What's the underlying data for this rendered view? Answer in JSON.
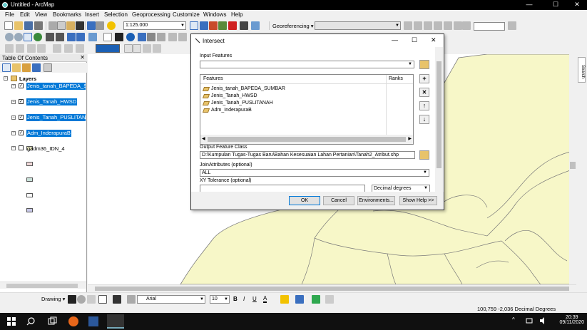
{
  "window": {
    "title": "Untitled - ArcMap",
    "minimize": "—",
    "maximize": "☐",
    "close": "✕"
  },
  "menu": [
    "File",
    "Edit",
    "View",
    "Bookmarks",
    "Insert",
    "Selection",
    "Geoprocessing",
    "Customize",
    "Windows",
    "Help"
  ],
  "toolbar": {
    "scale": "1:125.000",
    "georeferencing_label": "Georeferencing ▾"
  },
  "toc": {
    "title": "Table Of Contents",
    "close": "✕",
    "root": "Layers",
    "layers": [
      {
        "name": "Jenis_tanah_BAPEDA_SUMBAR",
        "checked": true,
        "selected": true,
        "color": "#f2f2c8"
      },
      {
        "name": "Jenis_Tanah_HWSD",
        "checked": true,
        "selected": true,
        "color": "#f0d8d8"
      },
      {
        "name": "Jenis_Tanah_PUSLITANAH",
        "checked": true,
        "selected": true,
        "color": "#c8e0d8"
      },
      {
        "name": "Adm_InderapuraB",
        "checked": true,
        "selected": true,
        "color": "#ffffff"
      },
      {
        "name": "gadm36_IDN_4",
        "checked": false,
        "selected": false,
        "color": "#c8c8e8"
      }
    ]
  },
  "dialog": {
    "title": "Intersect",
    "minimize": "—",
    "maximize": "☐",
    "close": "✕",
    "input_features_label": "Input Features",
    "features_header": "Features",
    "ranks_header": "Ranks",
    "features": [
      "Jenis_tanah_BAPEDA_SUMBAR",
      "Jenis_Tanah_HWSD",
      "Jenis_Tanah_PUSLITANAH",
      "Adm_InderapuraB"
    ],
    "output_label": "Output Feature Class",
    "output_value": "D:\\Kumpulan Tugas-Tugas Baru\\Bahan Kesesuaian Lahan Pertanian\\Tanah2_Atribut.shp",
    "join_label": "JoinAttributes (optional)",
    "join_value": "ALL",
    "xy_label": "XY Tolerance (optional)",
    "xy_value": "",
    "xy_unit": "Decimal degrees",
    "btn_add": "+",
    "btn_remove": "✕",
    "btn_up": "↑",
    "btn_down": "↓",
    "ok": "OK",
    "cancel": "Cancel",
    "environments": "Environments...",
    "help": "Show Help >>"
  },
  "drawing": {
    "label": "Drawing ▾",
    "font": "Arial",
    "size": "10",
    "bold": "B",
    "italic": "I",
    "underline": "U",
    "font_color": "A"
  },
  "search_tab": "Search",
  "status": {
    "coords": "100,759  -2,036 Decimal Degrees"
  },
  "taskbar": {
    "time": "20:39",
    "date": "09/11/2020"
  },
  "colors": {
    "selection": "#0078d7",
    "map_fill": "#f7f7c8",
    "boundary": "#7a7a7a"
  }
}
